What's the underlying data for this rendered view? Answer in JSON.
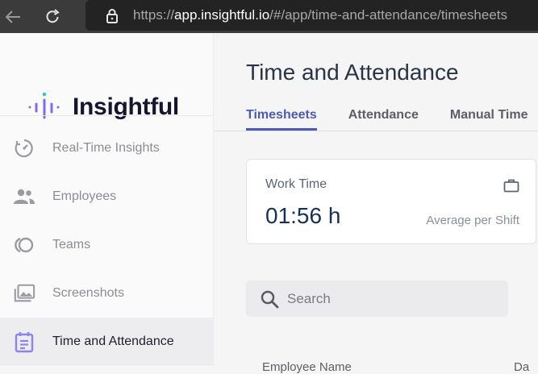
{
  "browser": {
    "url_prefix": "https://",
    "url_host": "app.insightful.io",
    "url_path": "/#/app/time-and-attendance/timesheets"
  },
  "sidebar": {
    "logo_text": "Insightful",
    "items": [
      {
        "label": "Real-Time Insights",
        "icon": "gauge-icon",
        "active": false
      },
      {
        "label": "Employees",
        "icon": "people-icon",
        "active": false
      },
      {
        "label": "Teams",
        "icon": "teams-icon",
        "active": false
      },
      {
        "label": "Screenshots",
        "icon": "screenshots-icon",
        "active": false
      },
      {
        "label": "Time and Attendance",
        "icon": "calendar-icon",
        "active": true
      }
    ]
  },
  "main": {
    "title": "Time and Attendance",
    "tabs": [
      {
        "label": "Timesheets",
        "active": true
      },
      {
        "label": "Attendance",
        "active": false
      },
      {
        "label": "Manual Time",
        "active": false
      }
    ],
    "work_card": {
      "label": "Work Time",
      "value": "01:56 h",
      "sub": "Average per Shift",
      "icon": "briefcase-icon"
    },
    "search": {
      "placeholder": "Search"
    },
    "table": {
      "col1_partial": "Employee Name",
      "col2_partial": "Da"
    }
  },
  "colors": {
    "accent": "#4b5bb5",
    "logo_purple": "#7b6cf0",
    "active_icon": "#8b84f0"
  }
}
